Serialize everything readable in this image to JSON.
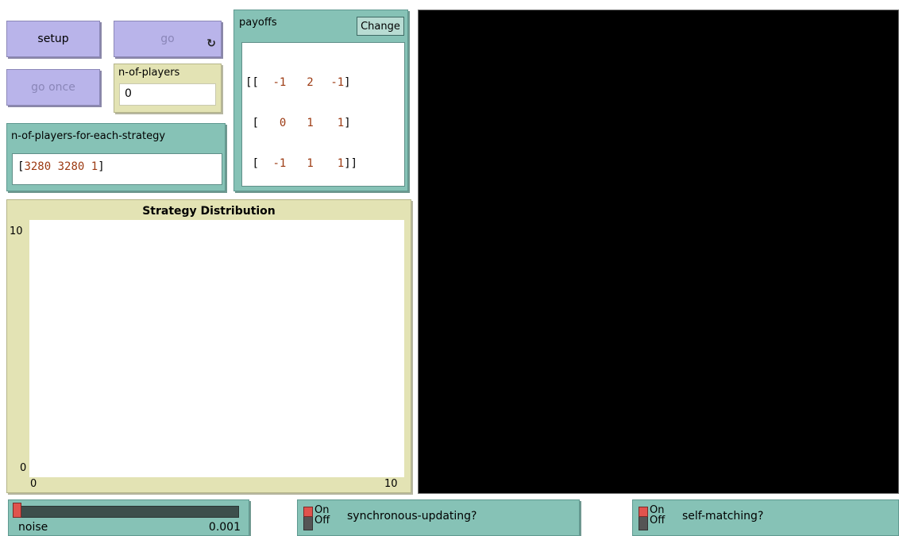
{
  "buttons": {
    "setup": "setup",
    "go": "go",
    "go_once": "go once"
  },
  "monitors": {
    "n_of_players": {
      "label": "n-of-players",
      "value": "0"
    },
    "n_of_players_each": {
      "label": "n-of-players-for-each-strategy",
      "value_open": "[",
      "values": [
        "3280",
        "3280",
        "1"
      ],
      "value_close": "]"
    }
  },
  "payoffs": {
    "label": "payoffs",
    "change_label": "Change",
    "rows": [
      {
        "open": "[[",
        "cells": [
          "-1",
          "2",
          "-1"
        ],
        "close": "]"
      },
      {
        "open": "[",
        "cells": [
          "0",
          "1",
          "1"
        ],
        "close": "]"
      },
      {
        "open": "[",
        "cells": [
          "-1",
          "1",
          "1"
        ],
        "close": "]]"
      }
    ]
  },
  "plot": {
    "title": "Strategy Distribution",
    "y_max": "10",
    "y_min": "0",
    "x_min": "0",
    "x_max": "10"
  },
  "slider": {
    "label": "noise",
    "value": "0.001"
  },
  "switches": {
    "synchronous": {
      "on": "On",
      "off": "Off",
      "label": "synchronous-updating?"
    },
    "self_matching": {
      "on": "On",
      "off": "Off",
      "label": "self-matching?"
    }
  },
  "colors": {
    "button": "#b9b4ea",
    "monitor": "#e3e3b4",
    "teal": "#86c2b6",
    "view_background": "#000000",
    "number_text": "#9c3a12"
  }
}
